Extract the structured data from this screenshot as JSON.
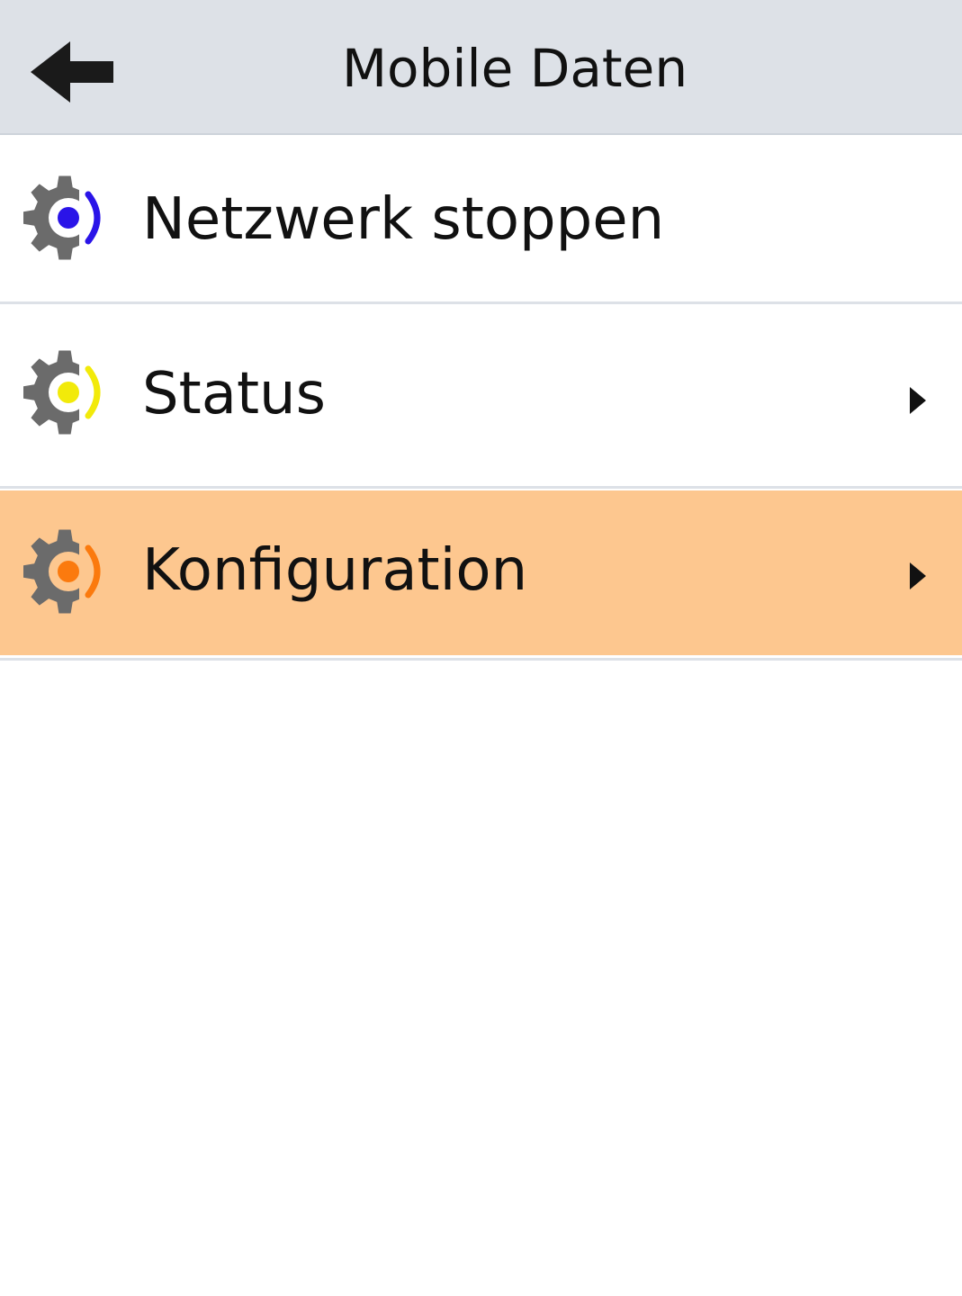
{
  "header": {
    "title": "Mobile Daten",
    "back_icon": "arrow-left-icon"
  },
  "menu": {
    "items": [
      {
        "label": "Netzwerk stoppen",
        "icon": "network-gear-icon",
        "icon_accent": "#2a14e8",
        "has_submenu": false,
        "selected": false
      },
      {
        "label": "Status",
        "icon": "network-gear-icon",
        "icon_accent": "#f2ea0a",
        "has_submenu": true,
        "selected": false
      },
      {
        "label": "Konfiguration",
        "icon": "network-gear-icon",
        "icon_accent": "#fb7a0e",
        "has_submenu": true,
        "selected": true
      }
    ]
  },
  "colors": {
    "header_background": "#dde1e7",
    "selected_background": "#fdc78f",
    "gear": "#6b6b6b",
    "text": "#111111"
  }
}
